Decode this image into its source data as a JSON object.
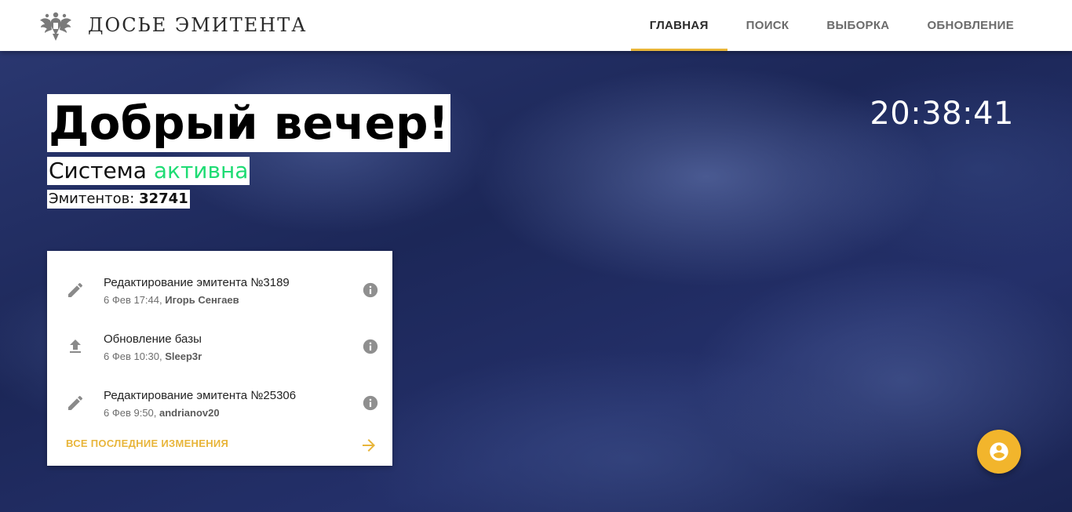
{
  "brand": {
    "title": "ДОСЬЕ ЭМИТЕНТА",
    "logo_icon": "double-headed-eagle-icon"
  },
  "nav": {
    "items": [
      {
        "label": "ГЛАВНАЯ",
        "active": true
      },
      {
        "label": "ПОИСК",
        "active": false
      },
      {
        "label": "ВЫБОРКА",
        "active": false
      },
      {
        "label": "ОБНОВЛЕНИЕ",
        "active": false
      }
    ]
  },
  "hero": {
    "greeting": "Добрый вечер!",
    "status_prefix": "Система",
    "status_value": "активна",
    "count_label": "Эмитентов:",
    "count_value": "32741",
    "clock": "20:38:41"
  },
  "activity": {
    "items": [
      {
        "icon": "pencil-icon",
        "title": "Редактирование эмитента №3189",
        "date": "6 Фев 17:44,",
        "user": "Игорь Сенгаев"
      },
      {
        "icon": "upload-icon",
        "title": "Обновление базы",
        "date": "6 Фев 10:30,",
        "user": "Sleep3r"
      },
      {
        "icon": "pencil-icon",
        "title": "Редактирование эмитента №25306",
        "date": "6 Фев 9:50,",
        "user": "andrianov20"
      }
    ],
    "footer_label": "ВСЕ ПОСЛЕДНИЕ ИЗМЕНЕНИЯ"
  },
  "colors": {
    "accent": "#e8b53a",
    "fab": "#f2b52c",
    "status_active": "#1fdc74"
  }
}
